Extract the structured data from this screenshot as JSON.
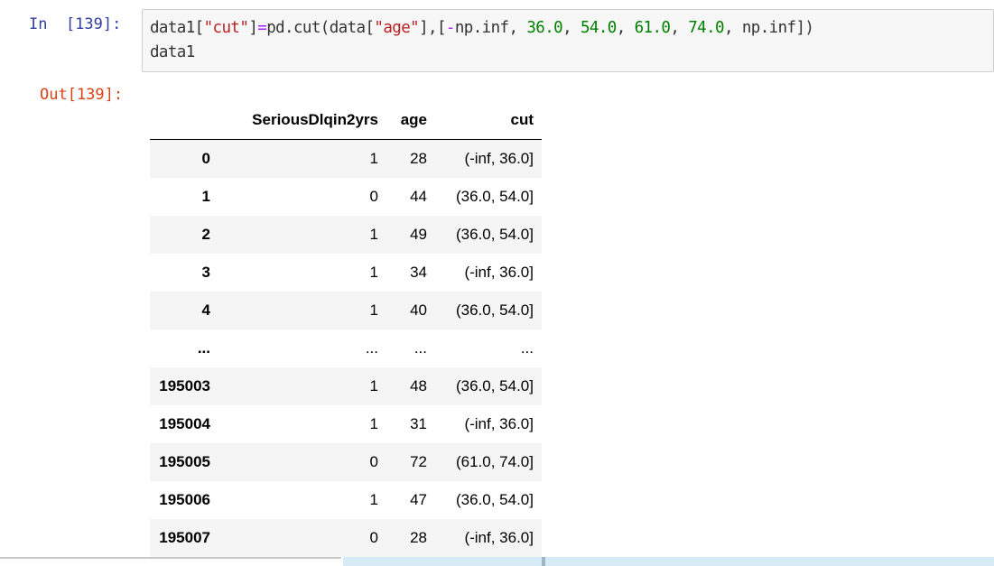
{
  "input_cell": {
    "prompt": "In  [139]:",
    "code_lines": [
      [
        {
          "t": "data1[",
          "c": ""
        },
        {
          "t": "\"cut\"",
          "c": "str"
        },
        {
          "t": "]",
          "c": ""
        },
        {
          "t": "=",
          "c": "op"
        },
        {
          "t": "pd.cut(data[",
          "c": ""
        },
        {
          "t": "\"age\"",
          "c": "str"
        },
        {
          "t": "],[",
          "c": ""
        },
        {
          "t": "-",
          "c": "op"
        },
        {
          "t": "np.inf, ",
          "c": ""
        },
        {
          "t": "36.0",
          "c": "num"
        },
        {
          "t": ", ",
          "c": ""
        },
        {
          "t": "54.0",
          "c": "num"
        },
        {
          "t": ", ",
          "c": ""
        },
        {
          "t": "61.0",
          "c": "num"
        },
        {
          "t": ", ",
          "c": ""
        },
        {
          "t": "74.0",
          "c": "num"
        },
        {
          "t": ", np.inf])",
          "c": ""
        }
      ],
      [
        {
          "t": "data1",
          "c": ""
        }
      ]
    ]
  },
  "output_cell": {
    "prompt": "Out[139]:",
    "table": {
      "columns": [
        "",
        "SeriousDlqin2yrs",
        "age",
        "cut"
      ],
      "rows": [
        {
          "index": "0",
          "values": [
            "1",
            "28",
            "(-inf, 36.0]"
          ]
        },
        {
          "index": "1",
          "values": [
            "0",
            "44",
            "(36.0, 54.0]"
          ]
        },
        {
          "index": "2",
          "values": [
            "1",
            "49",
            "(36.0, 54.0]"
          ]
        },
        {
          "index": "3",
          "values": [
            "1",
            "34",
            "(-inf, 36.0]"
          ]
        },
        {
          "index": "4",
          "values": [
            "1",
            "40",
            "(36.0, 54.0]"
          ]
        },
        {
          "index": "...",
          "values": [
            "...",
            "...",
            "..."
          ]
        },
        {
          "index": "195003",
          "values": [
            "1",
            "48",
            "(36.0, 54.0]"
          ]
        },
        {
          "index": "195004",
          "values": [
            "1",
            "31",
            "(-inf, 36.0]"
          ]
        },
        {
          "index": "195005",
          "values": [
            "0",
            "72",
            "(61.0, 74.0]"
          ]
        },
        {
          "index": "195006",
          "values": [
            "1",
            "47",
            "(36.0, 54.0]"
          ]
        },
        {
          "index": "195007",
          "values": [
            "0",
            "28",
            "(-inf, 36.0]"
          ]
        }
      ]
    }
  },
  "colors": {
    "in_prompt": "#303f9f",
    "out_prompt": "#d84315",
    "code_bg": "#f7f7f7",
    "string": "#ba2121",
    "operator": "#aa22ff",
    "number": "#008000",
    "row_stripe": "#f5f5f5"
  }
}
